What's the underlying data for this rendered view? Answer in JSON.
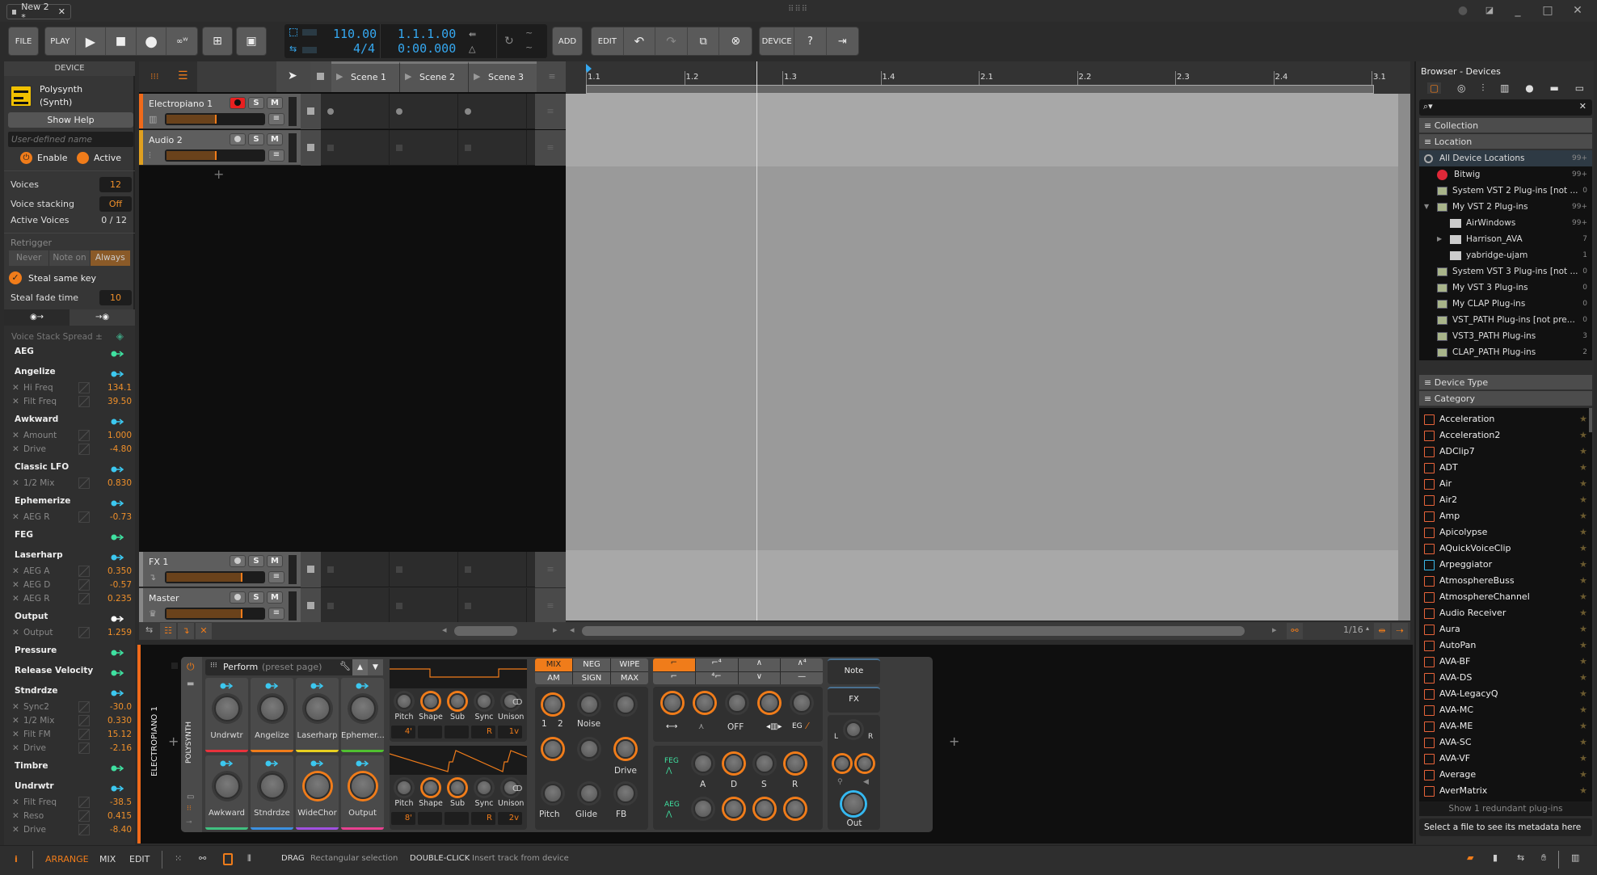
{
  "titlebar": {
    "tab_title": "New 2 *",
    "window_controls": [
      "record-indicator",
      "resize",
      "minimize",
      "maximize",
      "close"
    ]
  },
  "toolbar": {
    "file": "FILE",
    "play": "PLAY",
    "add": "ADD",
    "edit": "EDIT",
    "device": "DEVICE",
    "tempo": "110.00",
    "time_signature": "4/4",
    "position_bars": "1.1.1.00",
    "position_time": "0:00.000"
  },
  "device_panel": {
    "header": "DEVICE",
    "device_name": "Polysynth",
    "device_type": "(Synth)",
    "show_help": "Show Help",
    "name_placeholder": "User-defined name",
    "enable": "Enable",
    "active": "Active",
    "voices_label": "Voices",
    "voices_value": "12",
    "voice_stacking_label": "Voice stacking",
    "voice_stacking_value": "Off",
    "active_voices_label": "Active Voices",
    "active_voices_value": "0 / 12",
    "retrigger_label": "Retrigger",
    "retrigger_options": [
      "Never",
      "Note on",
      "Always"
    ],
    "retrigger_selected": "Always",
    "steal_same_key": "Steal same key",
    "steal_fade_label": "Steal fade time",
    "steal_fade_value": "10",
    "voice_stack_spread": "Voice Stack Spread ±",
    "modulators": [
      {
        "name": "AEG",
        "arrow": "#3fe0a0",
        "params": []
      },
      {
        "name": "Angelize",
        "arrow": "#3cc8f0",
        "params": [
          {
            "name": "Hi Freq",
            "value": "134.1"
          },
          {
            "name": "Filt Freq",
            "value": "39.50"
          }
        ]
      },
      {
        "name": "Awkward",
        "arrow": "#3cc8f0",
        "params": [
          {
            "name": "Amount",
            "value": "1.000"
          },
          {
            "name": "Drive",
            "value": "-4.80"
          }
        ]
      },
      {
        "name": "Classic LFO",
        "arrow": "#3cc8f0",
        "params": [
          {
            "name": "1/2 Mix",
            "value": "0.830"
          }
        ]
      },
      {
        "name": "Ephemerize",
        "arrow": "#3cc8f0",
        "params": [
          {
            "name": "AEG R",
            "value": "-0.73"
          }
        ]
      },
      {
        "name": "FEG",
        "arrow": "#3fe0a0",
        "params": []
      },
      {
        "name": "Laserharp",
        "arrow": "#3cc8f0",
        "params": [
          {
            "name": "AEG A",
            "value": "0.350"
          },
          {
            "name": "AEG D",
            "value": "-0.57"
          },
          {
            "name": "AEG R",
            "value": "0.235"
          }
        ]
      },
      {
        "name": "Output",
        "arrow": "#ffffff",
        "params": [
          {
            "name": "Output",
            "value": "1.259"
          }
        ]
      },
      {
        "name": "Pressure",
        "arrow": "#3fe0a0",
        "params": []
      },
      {
        "name": "Release Velocity",
        "arrow": "#3fe0a0",
        "params": []
      },
      {
        "name": "Stndrdze",
        "arrow": "#3cc8f0",
        "params": [
          {
            "name": "Sync2",
            "value": "-30.0"
          },
          {
            "name": "1/2 Mix",
            "value": "0.330"
          },
          {
            "name": "Filt FM",
            "value": "15.12"
          },
          {
            "name": "Drive",
            "value": "-2.16"
          }
        ]
      },
      {
        "name": "Timbre",
        "arrow": "#3fe0a0",
        "params": []
      },
      {
        "name": "Undrwtr",
        "arrow": "#3cc8f0",
        "params": [
          {
            "name": "Filt Freq",
            "value": "-38.5"
          },
          {
            "name": "Reso",
            "value": "0.415"
          },
          {
            "name": "Drive",
            "value": "-8.40"
          }
        ]
      }
    ]
  },
  "arranger": {
    "scenes": [
      "Scene 1",
      "Scene 2",
      "Scene 3"
    ],
    "tracks": [
      {
        "name": "Electropiano 1",
        "color": "#f06a1a",
        "armed": true,
        "volume": 0.52,
        "icon": "piano-icon",
        "clips": "dot"
      },
      {
        "name": "Audio 2",
        "color": "#e0a020",
        "armed": false,
        "volume": 0.52,
        "icon": "waveform-icon",
        "clips": "square"
      }
    ],
    "fx_tracks": [
      {
        "name": "FX 1",
        "color": "#888888",
        "volume": 0.78,
        "icon": "return-icon"
      },
      {
        "name": "Master",
        "color": "#888888",
        "volume": 0.78,
        "icon": "crown-icon"
      }
    ],
    "ruler": [
      "1.1",
      "1.2",
      "1.3",
      "1.4",
      "2.1",
      "2.2",
      "2.3",
      "2.4",
      "3.1"
    ],
    "grid": "1/16"
  },
  "device_chain": {
    "track_label": "ELECTROPIANO 1",
    "device_label": "POLYSYNTH",
    "preset_page": "Perform",
    "preset_page_hint": "(preset page)",
    "macros": [
      {
        "name": "Undrwtr",
        "color": "#e8323c"
      },
      {
        "name": "Angelize",
        "color": "#f07c1a"
      },
      {
        "name": "Laserharp",
        "color": "#e8d020"
      },
      {
        "name": "Ephemer...",
        "color": "#50c030"
      },
      {
        "name": "Awkward",
        "color": "#40c080"
      },
      {
        "name": "Stndrdze",
        "color": "#3c90e0"
      },
      {
        "name": "WideChor",
        "color": "#a050e0"
      },
      {
        "name": "Output",
        "color": "#e84090"
      }
    ],
    "osc1": {
      "labels": [
        "Pitch",
        "Shape",
        "Sub",
        "Sync",
        "Unison"
      ],
      "values": [
        "4'",
        "",
        "",
        "R",
        "1v"
      ]
    },
    "osc2": {
      "labels": [
        "Pitch",
        "Shape",
        "Sub",
        "Sync",
        "Unison"
      ],
      "values": [
        "8'",
        "",
        "",
        "R",
        "2v"
      ]
    },
    "mix_modes": [
      "MIX",
      "NEG",
      "WIPE",
      "AM",
      "SIGN",
      "MAX"
    ],
    "mix_selected": "MIX",
    "mixer_labels": [
      "1",
      "2",
      "Noise",
      "Drive",
      "Pitch",
      "Glide",
      "FB"
    ],
    "filter_mode": "OFF",
    "env_labels": [
      "FEG",
      "AEG"
    ],
    "adsr": [
      "A",
      "D",
      "S",
      "R"
    ],
    "note": "Note",
    "fx": "FX",
    "out": "Out",
    "pan_l": "L",
    "pan_r": "R"
  },
  "browser": {
    "title": "Browser - Devices",
    "sections": {
      "collection": "Collection",
      "location": "Location",
      "device_type": "Device Type",
      "category": "Category"
    },
    "locations": [
      {
        "name": "All Device Locations",
        "count": "99+",
        "level": 0,
        "icon": "circle"
      },
      {
        "name": "Bitwig",
        "count": "99+",
        "level": 1,
        "icon": "bitwig"
      },
      {
        "name": "System VST 2 Plug-ins [not ...",
        "count": "0",
        "level": 1,
        "icon": "plugin"
      },
      {
        "name": "My VST 2 Plug-ins",
        "count": "99+",
        "level": 1,
        "icon": "plugin",
        "expanded": true
      },
      {
        "name": "AirWindows",
        "count": "99+",
        "level": 2,
        "icon": "folder"
      },
      {
        "name": "Harrison_AVA",
        "count": "7",
        "level": 2,
        "icon": "folder",
        "collapsed": true
      },
      {
        "name": "yabridge-ujam",
        "count": "1",
        "level": 2,
        "icon": "folder"
      },
      {
        "name": "System VST 3 Plug-ins [not ...",
        "count": "0",
        "level": 1,
        "icon": "plugin"
      },
      {
        "name": "My VST 3 Plug-ins",
        "count": "0",
        "level": 1,
        "icon": "plugin"
      },
      {
        "name": "My CLAP Plug-ins",
        "count": "0",
        "level": 1,
        "icon": "plugin"
      },
      {
        "name": "VST_PATH Plug-ins [not pre...",
        "count": "0",
        "level": 1,
        "icon": "plugin"
      },
      {
        "name": "VST3_PATH Plug-ins",
        "count": "3",
        "level": 1,
        "icon": "plugin"
      },
      {
        "name": "CLAP_PATH Plug-ins",
        "count": "2",
        "level": 1,
        "icon": "plugin"
      }
    ],
    "devices": [
      "Acceleration",
      "Acceleration2",
      "ADClip7",
      "ADT",
      "Air",
      "Air2",
      "Amp",
      "Apicolypse",
      "AQuickVoiceClip",
      "Arpeggiator",
      "AtmosphereBuss",
      "AtmosphereChannel",
      "Audio Receiver",
      "Aura",
      "AutoPan",
      "AVA-BF",
      "AVA-DS",
      "AVA-LegacyQ",
      "AVA-MC",
      "AVA-ME",
      "AVA-SC",
      "AVA-VF",
      "Average",
      "AverMatrix"
    ],
    "redundant": "Show 1 redundant plug-ins",
    "metadata": "Select a file to see its metadata here"
  },
  "statusbar": {
    "views": [
      "ARRANGE",
      "MIX",
      "EDIT"
    ],
    "active_view": "ARRANGE",
    "hint1_key": "DRAG",
    "hint1_text": "Rectangular selection",
    "hint2_key": "DOUBLE-CLICK",
    "hint2_text": "Insert track from device"
  },
  "colors": {
    "accent": "#f07c1a",
    "lcd": "#35a8f0",
    "record": "#e02020"
  }
}
